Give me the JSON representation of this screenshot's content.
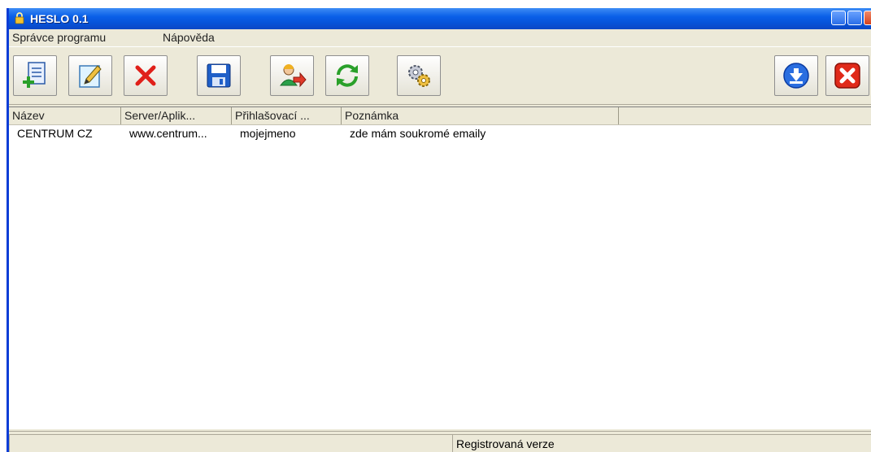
{
  "window": {
    "title": "HESLO 0.1"
  },
  "menu": {
    "items": [
      {
        "label": "Správce programu"
      },
      {
        "label": "Nápověda"
      }
    ]
  },
  "toolbar": {
    "buttons": [
      {
        "icon": "add-document-icon"
      },
      {
        "icon": "edit-pencil-icon"
      },
      {
        "icon": "delete-x-icon"
      },
      {
        "icon": "save-floppy-icon"
      },
      {
        "icon": "user-transfer-icon"
      },
      {
        "icon": "refresh-icon"
      },
      {
        "icon": "settings-gears-icon"
      },
      {
        "icon": "download-icon"
      },
      {
        "icon": "exit-icon"
      }
    ]
  },
  "table": {
    "columns": [
      "Název",
      "Server/Aplik...",
      "Přihlašovací ...",
      "Poznámka"
    ],
    "rows": [
      [
        "CENTRUM CZ",
        "www.centrum...",
        "mojejmeno",
        "zde mám soukromé emaily"
      ]
    ]
  },
  "status": {
    "text": "Registrovaná verze"
  },
  "colors": {
    "titlebar": "#0a5fe8",
    "window_bg": "#ece9d8",
    "delete_red": "#e0201a",
    "exit_red": "#e02a1a"
  }
}
